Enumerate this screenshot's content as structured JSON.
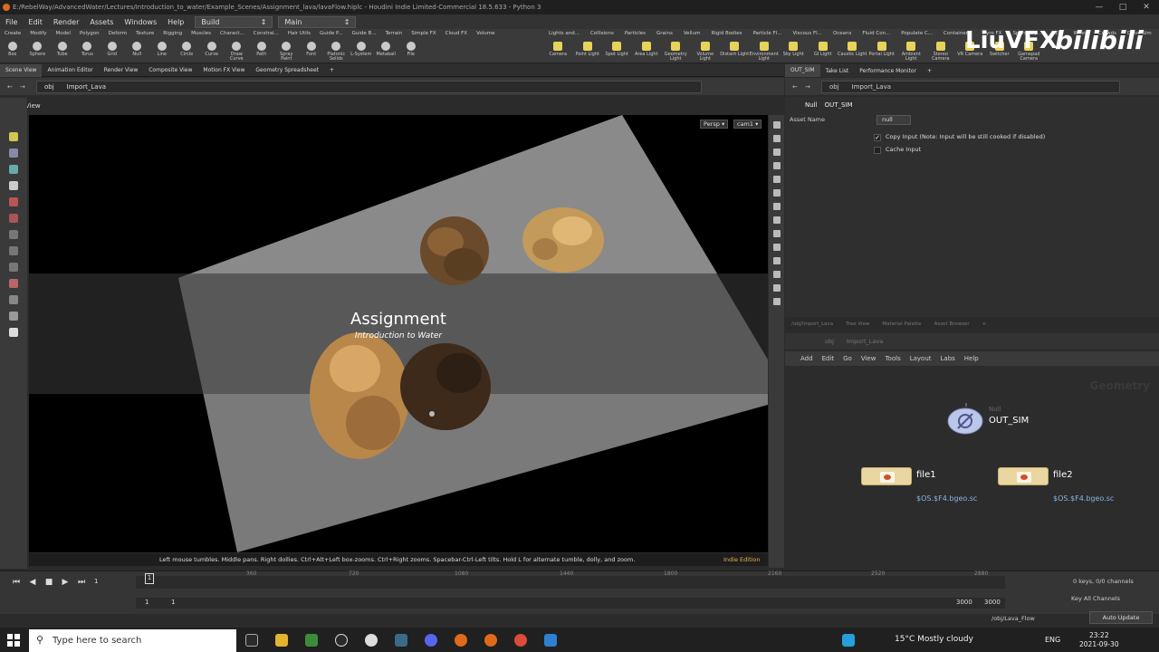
{
  "window": {
    "title": "E:/RebelWay/AdvancedWater/Lectures/Introduction_to_water/Example_Scenes/Assignment_lava/lavaFlow.hiplc - Houdini Indie Limited-Commercial 18.5.633 - Python 3"
  },
  "menu": {
    "items": [
      "File",
      "Edit",
      "Render",
      "Assets",
      "Windows",
      "Help"
    ],
    "build_label": "Build",
    "main_label": "Main"
  },
  "shelf": {
    "tabs": [
      "Create",
      "Modify",
      "Model",
      "Polygon",
      "Deform",
      "Texture",
      "Rigging",
      "Muscles",
      "Charact...",
      "Constrai...",
      "Hair Utils",
      "Guide P...",
      "Guide B...",
      "Terrain",
      "Simple FX",
      "Cloud FX",
      "Volume"
    ],
    "tools": [
      "Box",
      "Sphere",
      "Tube",
      "Torus",
      "Grid",
      "Null",
      "Line",
      "Circle",
      "Curve",
      "Draw Curve",
      "Path",
      "Spray Paint",
      "Font",
      "Platonic Solids",
      "L-System",
      "Metaball",
      "File"
    ],
    "tabs2": [
      "Lights and...",
      "Collisions",
      "Particles",
      "Grains",
      "Vellum",
      "Rigid Bodies",
      "Particle Fl...",
      "Viscous Fl...",
      "Oceans",
      "Fluid Con...",
      "Populate C...",
      "Container...",
      "Pyro FX",
      "Sparse Py...",
      "FEM",
      "Wires",
      "Crowds",
      "Drive Sim"
    ],
    "tools2": [
      "Camera",
      "Point Light",
      "Spot Light",
      "Area Light",
      "Geometry Light",
      "Volume Light",
      "Distant Light",
      "Environment Light",
      "Sky Light",
      "GI Light",
      "Caustic Light",
      "Portal Light",
      "Ambient Light",
      "Stereo Camera",
      "VR Camera",
      "Switcher",
      "Gamepad Camera"
    ]
  },
  "watermark": {
    "brand": "LiuVFX",
    "site": "bilibili"
  },
  "left_pane": {
    "tabs": [
      "Scene View",
      "Animation Editor",
      "Render View",
      "Composite View",
      "Motion FX View",
      "Geometry Spreadsheet"
    ],
    "path_root": "obj",
    "path_node": "Import_Lava",
    "view_label": "View",
    "persp": "Persp",
    "cam": "cam1",
    "overlay_title": "Assignment",
    "overlay_subtitle": "Introduction to Water",
    "status": "Left mouse tumbles. Middle pans. Right dollies. Ctrl+Alt+Left box-zooms. Ctrl+Right zooms. Spacebar-Ctrl-Left tilts. Hold L for alternate tumble, dolly, and zoom.",
    "edition": "Indie Edition"
  },
  "right_pane": {
    "tabs": [
      "OUT_SIM",
      "Take List",
      "Performance Monitor"
    ],
    "path_root": "obj",
    "path_node": "Import_Lava",
    "node_type": "Null",
    "node_name": "OUT_SIM",
    "asset_name_label": "Asset Name",
    "asset_name_value": "null",
    "copy_input_label": "Copy Input (Note: Input will be still cooked if disabled)",
    "copy_input_checked": true,
    "cache_input_label": "Cache Input",
    "cache_input_checked": false
  },
  "network": {
    "tabs": [
      "/obj/Import_Lava",
      "Tree View",
      "Material Palette",
      "Asset Browser"
    ],
    "path_root": "obj",
    "path_node": "Import_Lava",
    "menu": [
      "Add",
      "Edit",
      "Go",
      "View",
      "Tools",
      "Layout",
      "Labs",
      "Help"
    ],
    "context_label": "Geometry",
    "null_type": "Null",
    "null_name": "OUT_SIM",
    "file1_name": "file1",
    "file1_expr": "$OS.$F4.bgeo.sc",
    "file2_name": "file2",
    "file2_expr": "$OS.$F4.bgeo.sc"
  },
  "timeline": {
    "current_frame": "1",
    "ticks": [
      "360",
      "720",
      "1080",
      "1440",
      "1800",
      "2160",
      "2520",
      "2880"
    ],
    "start": "1",
    "start2": "1",
    "end": "3000",
    "end2": "3000",
    "keys_info": "0 keys, 0/0 channels",
    "key_all": "Key All Channels",
    "path": "/obj/Lava_Flow",
    "auto_update": "Auto Update"
  },
  "taskbar": {
    "search_placeholder": "Type here to search",
    "weather": "15°C  Mostly cloudy",
    "lang": "ENG",
    "time": "23:22",
    "date": "2021-09-30"
  },
  "colors": {
    "accent": "#e8b34a",
    "node_file": "#e9d6a1",
    "expr": "#8ab3e6"
  }
}
